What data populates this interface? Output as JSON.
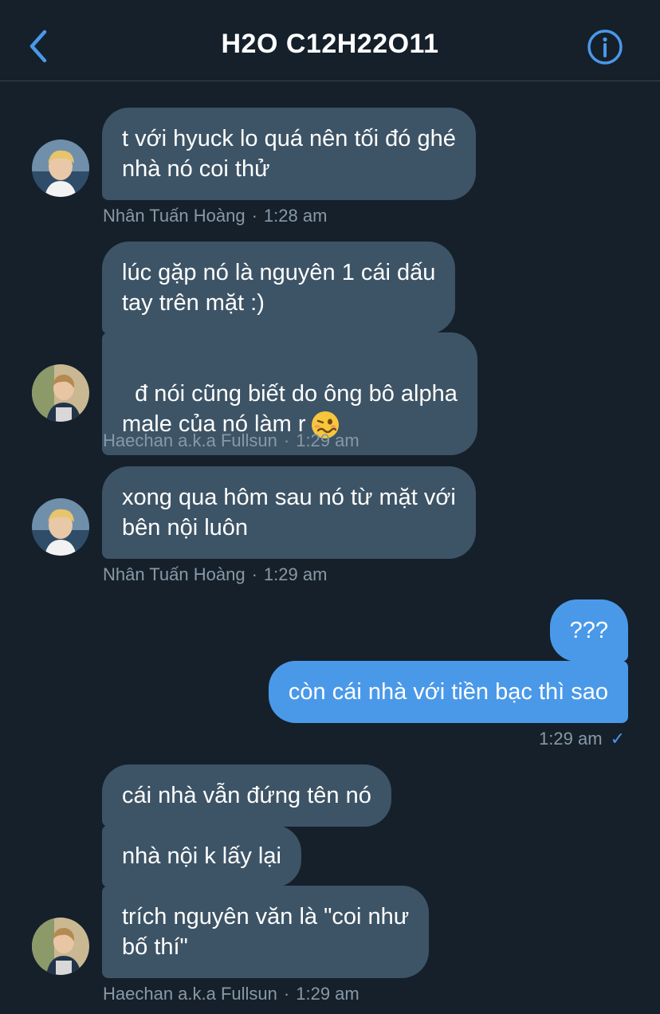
{
  "header": {
    "title": "H2O C12H22O11",
    "back_icon": "chevron-left-icon",
    "info_icon": "info-icon",
    "accent": "#4a99e9"
  },
  "messages": [
    {
      "text": "t với hyuck lo quá nên tối đó ghé\nnhà nó coi thử"
    },
    {
      "sender": "Nhân Tuấn Hoàng",
      "time": "1:28 am"
    },
    {
      "text": "lúc gặp nó là nguyên 1 cái dấu\ntay trên mặt :)"
    },
    {
      "text": "đ nói cũng biết do ông bô alpha\nmale của nó làm r",
      "emoji": "woozy-face"
    },
    {
      "sender": "Haechan a.k.a Fullsun",
      "time": "1:29 am"
    },
    {
      "text": "xong qua hôm sau nó từ mặt với\nbên nội luôn"
    },
    {
      "sender": "Nhân Tuấn Hoàng",
      "time": "1:29 am"
    },
    {
      "text": "???"
    },
    {
      "text": "còn cái nhà với tiền bạc thì sao"
    },
    {
      "time": "1:29 am",
      "status": "✓"
    },
    {
      "text": "cái nhà vẫn đứng tên nó"
    },
    {
      "text": "nhà nội k lấy lại"
    },
    {
      "text": "trích nguyên văn là \"coi như\nbố thí\""
    },
    {
      "sender": "Haechan a.k.a Fullsun",
      "time": "1:29 am"
    }
  ],
  "colors": {
    "background": "#15202b",
    "incoming_bubble": "#3d5466",
    "outgoing_bubble": "#4a99e9",
    "meta_text": "#8899a6"
  }
}
